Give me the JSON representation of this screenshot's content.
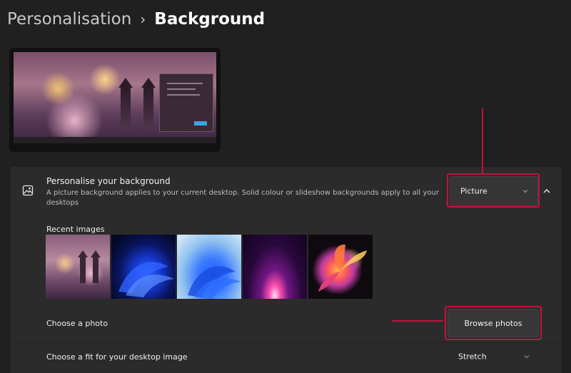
{
  "breadcrumb": {
    "parent": "Personalisation",
    "separator": "›",
    "current": "Background"
  },
  "background_setting": {
    "title": "Personalise your background",
    "description": "A picture background applies to your current desktop. Solid colour or slideshow backgrounds apply to all your desktops",
    "icon": "picture-icon",
    "type_selected": "Picture",
    "expand_icon": "chevron-up-icon"
  },
  "recent_images": {
    "label": "Recent images",
    "items": [
      "city-night",
      "bloom-dark",
      "bloom-light",
      "glow-arc",
      "flower"
    ]
  },
  "choose_photo": {
    "label": "Choose a photo",
    "button_label": "Browse photos"
  },
  "choose_fit": {
    "label": "Choose a fit for your desktop image",
    "selected": "Stretch"
  },
  "colors": {
    "highlight": "#c0143c",
    "page_bg": "#202020",
    "card_bg": "#2b2b2b"
  }
}
